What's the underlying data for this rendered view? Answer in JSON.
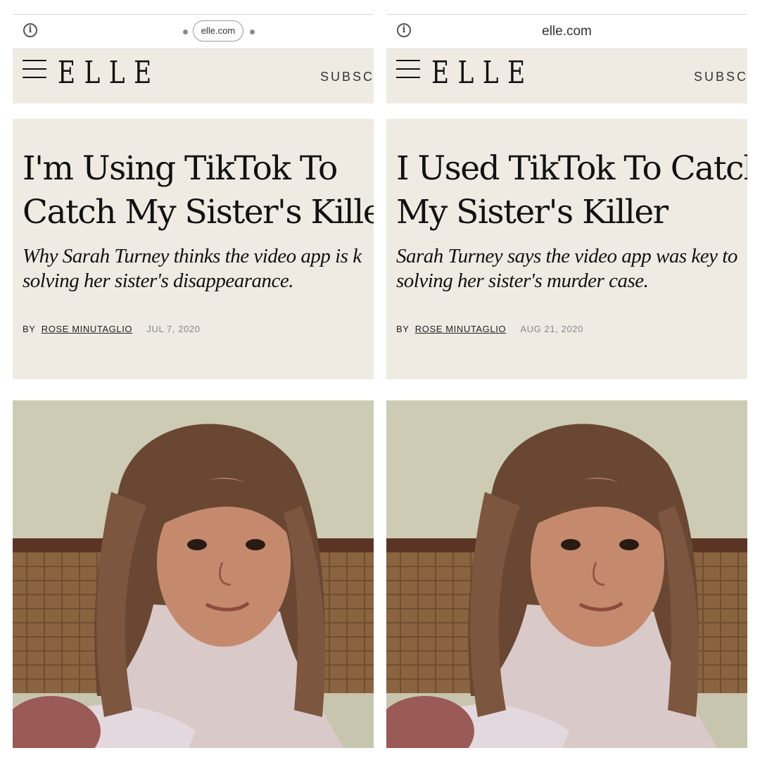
{
  "panels": [
    {
      "url": "elle.com",
      "brand": "ELLE",
      "subscribe_label": "SUBSCR",
      "headline": "I'm Using TikTok To\nCatch My Sister's Killer",
      "dek": "Why Sarah Turney thinks the video app is k\nsolving her sister's disappearance.",
      "byline_prefix": "BY",
      "author": "ROSE MINUTAGLIO",
      "date": "JUL 7, 2020"
    },
    {
      "url": "elle.com",
      "brand": "ELLE",
      "subscribe_label": "SUBSCR",
      "headline": "I Used TikTok To Catch\nMy Sister's Killer",
      "dek": "Sarah Turney says the video app was key to\nsolving her sister's murder case.",
      "byline_prefix": "BY",
      "author": "ROSE MINUTAGLIO",
      "date": "AUG 21, 2020"
    }
  ],
  "icons": {
    "info": "info-circle-icon",
    "menu": "hamburger-menu-icon"
  },
  "colors": {
    "site_background": "#efebe3",
    "text": "#111111",
    "date": "#888888"
  }
}
